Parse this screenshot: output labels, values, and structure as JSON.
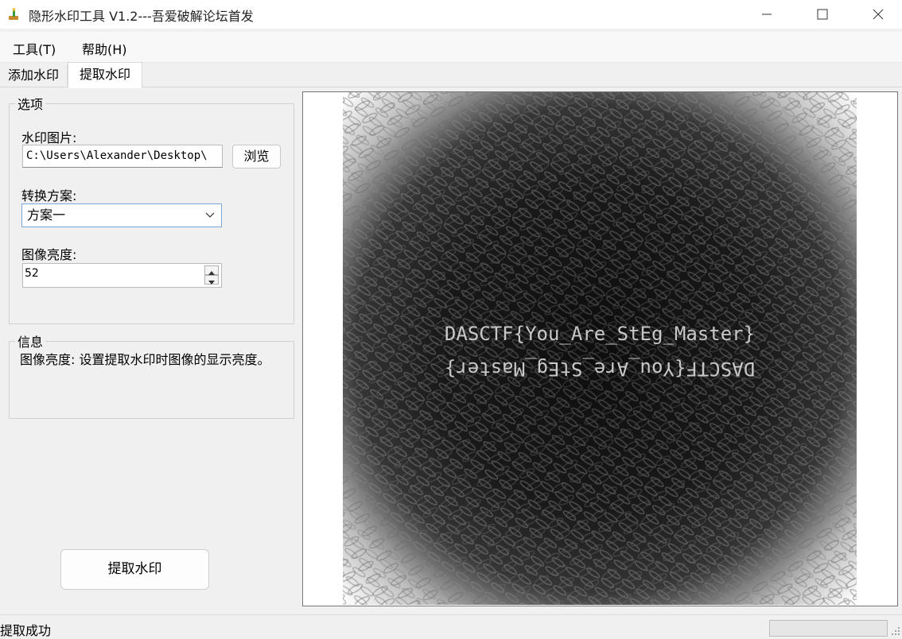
{
  "window": {
    "title": "隐形水印工具 V1.2---吾爱破解论坛首发",
    "icon": "app-brush-icon"
  },
  "menu": {
    "items": [
      {
        "label": "工具(T)"
      },
      {
        "label": "帮助(H)"
      }
    ]
  },
  "tabs": [
    {
      "label": "添加水印",
      "active": false
    },
    {
      "label": "提取水印",
      "active": true
    }
  ],
  "options": {
    "group_title": "选项",
    "watermark_label": "水印图片:",
    "watermark_path": "C:\\Users\\Alexander\\Desktop\\",
    "browse_label": "浏览",
    "scheme_label": "转换方案:",
    "scheme_value": "方案一",
    "brightness_label": "图像亮度:",
    "brightness_value": "52"
  },
  "info": {
    "group_title": "信息",
    "text": "图像亮度: 设置提取水印时图像的显示亮度。"
  },
  "actions": {
    "extract_label": "提取水印"
  },
  "preview": {
    "text_top": "DASCTF{You_Are_StEg_Master}",
    "text_bottom": "DASCTF{You_Are_StEg_Master}"
  },
  "status": {
    "text": "提取成功",
    "progress": 0
  },
  "colors": {
    "accent_border": "#7aa6da",
    "window_bg": "#f0f0f0"
  }
}
